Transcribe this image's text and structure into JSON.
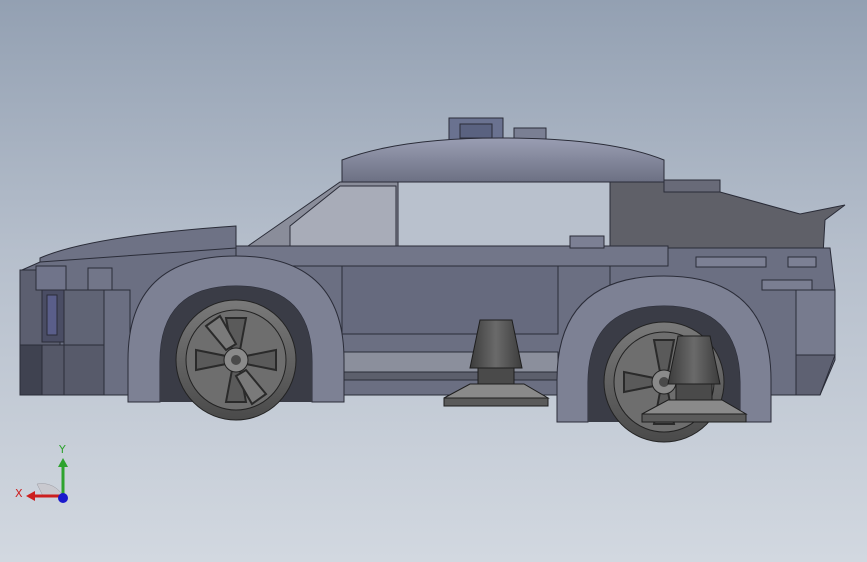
{
  "viewport": {
    "background_top": "#93a0b2",
    "background_bottom": "#d2d8e0"
  },
  "model": {
    "body_color": "#6b6f82",
    "body_light": "#8a8fa3",
    "body_dark": "#4f5262",
    "wheel_color": "#5e5e5e"
  },
  "triad": {
    "x_label": "X",
    "y_label": "Y",
    "x_color": "#cc1f1f",
    "y_color": "#2ea32e",
    "z_color": "#1a1acc"
  }
}
